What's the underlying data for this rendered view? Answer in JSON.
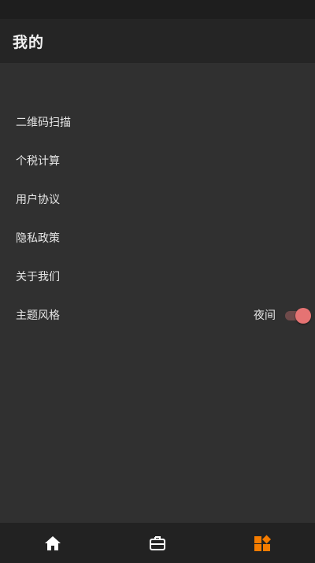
{
  "header": {
    "title": "我的"
  },
  "menu": {
    "items": [
      {
        "label": "二维码扫描"
      },
      {
        "label": "个税计算"
      },
      {
        "label": "用户协议"
      },
      {
        "label": "隐私政策"
      },
      {
        "label": "关于我们"
      }
    ],
    "theme": {
      "label": "主题风格",
      "value": "夜间",
      "enabled": true
    }
  },
  "bottom_nav": {
    "items": [
      {
        "icon": "home-icon",
        "active": false
      },
      {
        "icon": "briefcase-icon",
        "active": false
      },
      {
        "icon": "apps-icon",
        "active": true
      }
    ],
    "active_color": "#f57c00",
    "inactive_color": "#ffffff"
  },
  "colors": {
    "switch_thumb": "#e57373",
    "switch_track": "#6e4a4a",
    "background": "#303030"
  }
}
